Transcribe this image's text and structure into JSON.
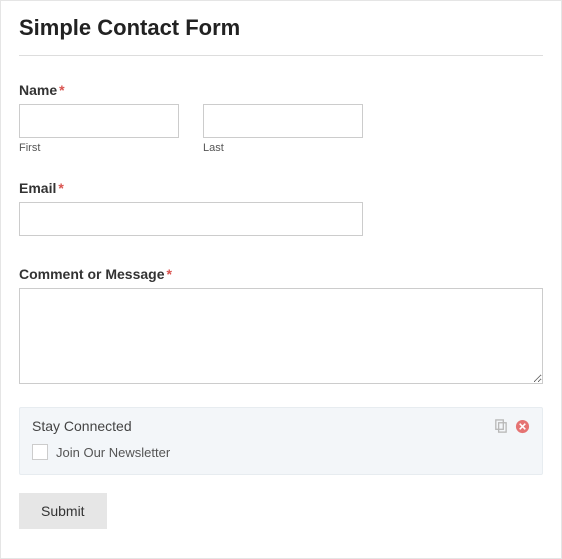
{
  "title": "Simple Contact Form",
  "name": {
    "label": "Name",
    "required": "*",
    "first_sublabel": "First",
    "last_sublabel": "Last",
    "first_value": "",
    "last_value": ""
  },
  "email": {
    "label": "Email",
    "required": "*",
    "value": ""
  },
  "comment": {
    "label": "Comment or Message",
    "required": "*",
    "value": ""
  },
  "stay_connected": {
    "title": "Stay Connected",
    "checkbox_label": "Join Our Newsletter"
  },
  "submit_label": "Submit"
}
